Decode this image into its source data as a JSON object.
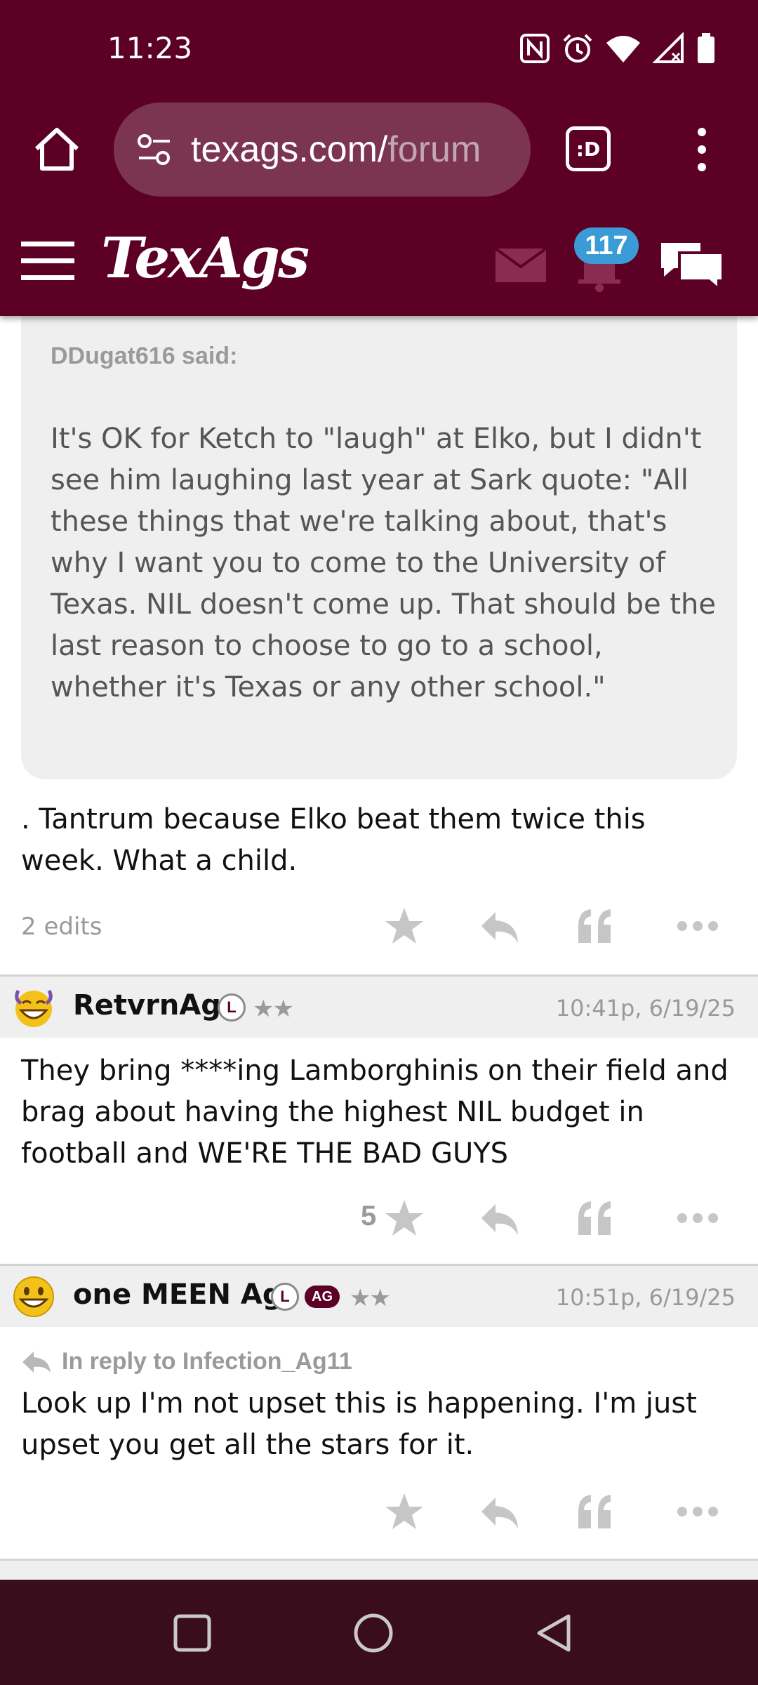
{
  "status_bar": {
    "time": "11:23",
    "icons": [
      "nfc-icon",
      "alarm-icon",
      "wifi-icon",
      "signal-icon",
      "battery-icon"
    ]
  },
  "browser": {
    "url_main": "texags.com/",
    "url_dim": "forum",
    "tab_switch_label": ":D"
  },
  "site": {
    "logo": "TexAgs",
    "notification_count": "117"
  },
  "colors": {
    "maroon": "#5c0125",
    "badge_blue": "#3b9bd6",
    "nav_dark": "#3a0d1c"
  },
  "posts": [
    {
      "quote_author": "DDugat616 said:",
      "quote_text": "It's OK for Ketch to \"laugh\" at Elko, but I didn't see him laughing last year at Sark quote: \"All these things that we're talking about, that's why I want you to come to the University of Texas. NIL doesn't come up. That should be the last reason to choose to go to a school, whether it's Texas or any other school.\"",
      "body": ". Tantrum because Elko beat them twice this week. What a child.",
      "edits": "2 edits"
    },
    {
      "username": "RetvrnAg",
      "badge_l": "L",
      "stars": "★★",
      "time": "10:41p, 6/19/25",
      "body": "They bring ****ing Lamborghinis on their field and brag about having the highest NIL budget in football and WE'RE THE BAD GUYS",
      "star_count": "5"
    },
    {
      "username": "one MEEN Ag",
      "badge_l": "L",
      "badge_ag": "AG",
      "stars": "★★",
      "time": "10:51p, 6/19/25",
      "reply_to": "In reply to Infection_Ag11",
      "body": "Look up I'm not upset this is happening. I'm just upset you get all the stars for it."
    }
  ]
}
